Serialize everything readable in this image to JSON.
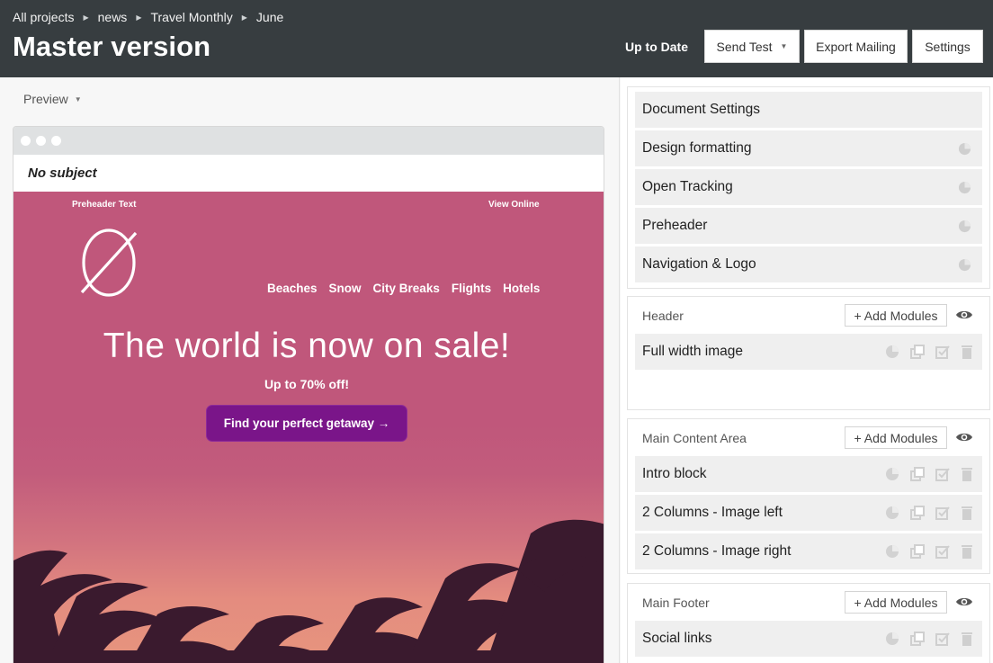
{
  "breadcrumbs": [
    "All projects",
    "news",
    "Travel Monthly",
    "June"
  ],
  "page_title": "Master version",
  "toolbar": {
    "status": "Up to Date",
    "send_test": "Send Test",
    "export": "Export Mailing",
    "settings": "Settings"
  },
  "preview": {
    "dropdown_label": "Preview",
    "subject": "No subject"
  },
  "email": {
    "preheader": "Preheader Text",
    "view_online": "View Online",
    "nav": [
      "Beaches",
      "Snow",
      "City Breaks",
      "Flights",
      "Hotels"
    ],
    "headline": "The world is now on sale!",
    "subheadline": "Up to 70% off!",
    "cta": "Find your perfect getaway →"
  },
  "settings_panel": {
    "document_rows": [
      {
        "label": "Document Settings",
        "icon": "none"
      },
      {
        "label": "Design formatting",
        "icon": "pie-icon"
      },
      {
        "label": "Open Tracking",
        "icon": "pie-icon"
      },
      {
        "label": "Preheader",
        "icon": "pie-icon"
      },
      {
        "label": "Navigation & Logo",
        "icon": "pie-icon"
      }
    ],
    "add_modules_label": "+ Add Modules",
    "sections": [
      {
        "title": "Header",
        "modules": [
          "Full width image"
        ]
      },
      {
        "title": "Main Content Area",
        "modules": [
          "Intro block",
          "2 Columns - Image left",
          "2 Columns - Image right"
        ]
      },
      {
        "title": "Main Footer",
        "modules": [
          "Social links"
        ]
      }
    ],
    "module_icons": [
      "pie-icon",
      "duplicate-icon",
      "check-icon",
      "trash-icon"
    ]
  },
  "colors": {
    "topbar": "#373d40",
    "email_bg": "#c0577b",
    "cta_bg": "#7a1589",
    "row_bg": "#efefef"
  }
}
